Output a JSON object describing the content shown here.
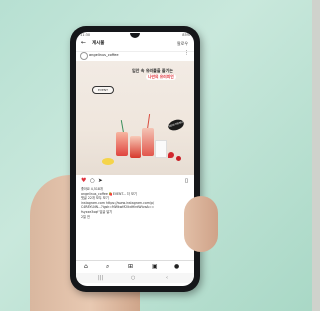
{
  "status_bar": {
    "time": "11:30",
    "battery": "85%"
  },
  "top_bar": {
    "back_icon": "back-arrow-icon",
    "title": "게시물",
    "follow_label": "팔로우"
  },
  "post_header": {
    "username": "angelinus_coffee"
  },
  "post_image": {
    "headline": "입안 속 유러플을 즐기는",
    "headline_highlight": "나만의 유러피언",
    "pill_label": "EVENT",
    "badge_label": "NEW MENU"
  },
  "caption": {
    "likes": "좋아요 4,518개",
    "line1": "angelinus_coffee 🍓EVENT... 더 보기",
    "line2": "댓글 22개 모두 보기",
    "line3": "instagram.com https://www.instagram.com/p/",
    "line4": "C4R8YLNN...?igsh=MWkwM2lkdHlrdWtvaA==",
    "line5": "fsyxxe3oqf 답글 달기",
    "line6": "2일 전"
  },
  "nav": {
    "home_icon": "home-icon",
    "search_icon": "search-icon",
    "add_icon": "add-icon",
    "reels_icon": "reels-icon",
    "profile_icon": "profile-icon"
  }
}
